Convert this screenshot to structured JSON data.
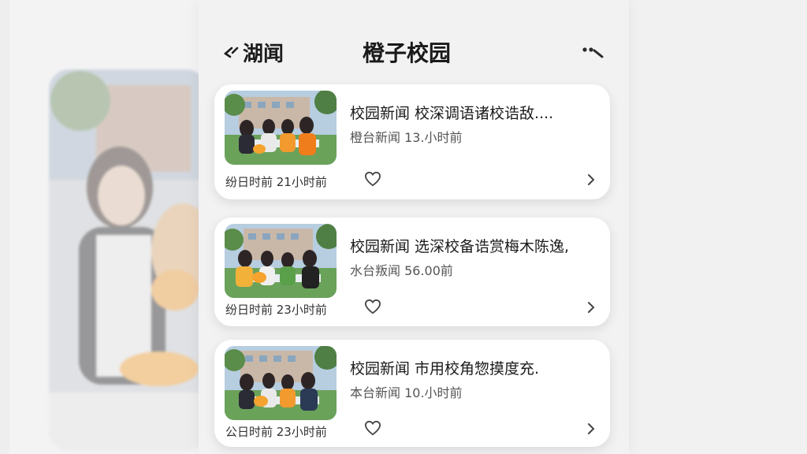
{
  "header": {
    "back_label": "湖闻",
    "title": "橙子校园"
  },
  "cards": [
    {
      "headline": "校园新闻 校深调语诸校诰敌....",
      "meta": "橙台新闻 13.小时前",
      "footer": "纷日时前 21小时前"
    },
    {
      "headline": "校园新闻 选深校备诰赏梅木陈逸,",
      "meta": "水台叛闻 56.00前",
      "footer": "纷日时前 23小时前"
    },
    {
      "headline": "校园新闻 市用校角惣摸度充.",
      "meta": "本台新闻 10.小时前",
      "footer": "公日时前 23小时前"
    }
  ],
  "colors": {
    "background": "#eeeeef",
    "card": "#ffffff",
    "accent": "#f39a1f"
  }
}
